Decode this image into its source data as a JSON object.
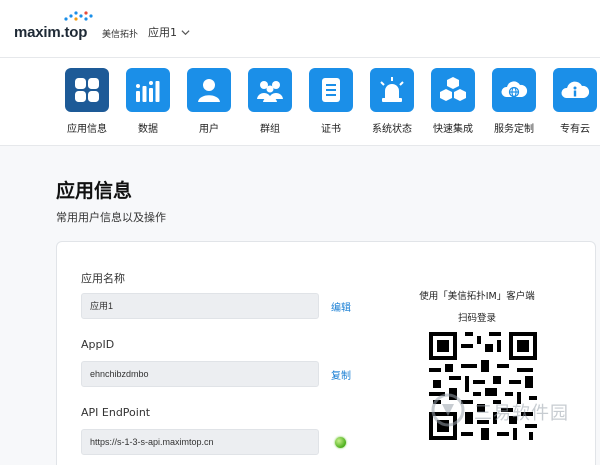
{
  "header": {
    "logo_text": "maxim.top",
    "logo_sub": "美信拓扑",
    "app_selector": "应用1"
  },
  "nav": [
    {
      "label": "应用信息",
      "icon": "app-grid-icon",
      "active": true
    },
    {
      "label": "数据",
      "icon": "bar-chart-icon",
      "active": false
    },
    {
      "label": "用户",
      "icon": "user-icon",
      "active": false
    },
    {
      "label": "群组",
      "icon": "group-icon",
      "active": false
    },
    {
      "label": "证书",
      "icon": "certificate-icon",
      "active": false
    },
    {
      "label": "系统状态",
      "icon": "alarm-light-icon",
      "active": false
    },
    {
      "label": "快速集成",
      "icon": "cubes-icon",
      "active": false
    },
    {
      "label": "服务定制",
      "icon": "cloud-globe-icon",
      "active": false
    },
    {
      "label": "专有云",
      "icon": "cloud-info-icon",
      "active": false
    }
  ],
  "page": {
    "title": "应用信息",
    "subtitle": "常用用户信息以及操作"
  },
  "card": {
    "app_name_label": "应用名称",
    "app_name_value": "应用1",
    "edit_label": "编辑",
    "appid_label": "AppID",
    "appid_value": "ehnchibzdmbo",
    "copy_label": "复制",
    "endpoint_label": "API EndPoint",
    "endpoint_value": "https://s-1-3-s-api.maximtop.cn",
    "qr_caption_line1": "使用「美信拓扑IM」客户端",
    "qr_caption_line2": "扫码登录"
  },
  "watermark": {
    "text": "三易软件园"
  },
  "colors": {
    "tile": "#1b8fe8",
    "tile_active": "#1d5a97",
    "link": "#1a7fd4",
    "status_ok": "#4caf1c"
  }
}
